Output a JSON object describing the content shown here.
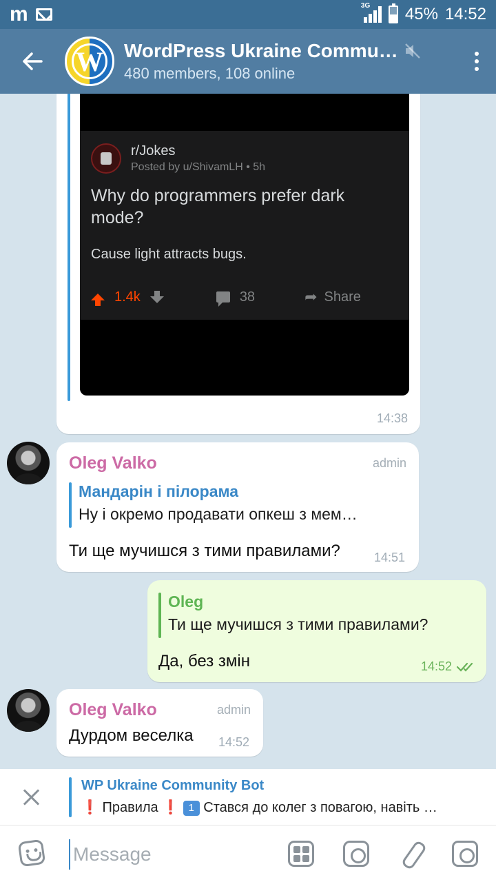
{
  "statusbar": {
    "app_icon": "m",
    "network": "3G",
    "battery": "45%",
    "time": "14:52"
  },
  "header": {
    "title": "WordPress Ukraine Commu…",
    "subtitle": "480 members, 108 online",
    "avatar_letter": "W",
    "mute_icon": "mute-icon"
  },
  "messages": [
    {
      "type": "image",
      "time": "14:38",
      "reddit": {
        "subreddit": "r/Jokes",
        "posted": "Posted by u/ShivamLH • 5h",
        "title": "Why do programmers prefer dark mode?",
        "body": "Cause light attracts bugs.",
        "upvotes": "1.4k",
        "comments": "38",
        "share": "Share"
      }
    },
    {
      "type": "reply",
      "sender": "Oleg Valko",
      "badge": "admin",
      "reply_name": "Мандарін і пілорама",
      "reply_text": "Ну і окремо продавати опкеш з мем…",
      "text": "Ти ще мучишся з тими правилами?",
      "time": "14:51"
    },
    {
      "type": "outgoing",
      "reply_name": "Oleg",
      "reply_text": "Ти ще мучишся з тими правилами?",
      "text": "Да, без змін",
      "time": "14:52"
    },
    {
      "type": "text",
      "sender": "Oleg Valko",
      "badge": "admin",
      "text": "Дурдом веселка",
      "time": "14:52"
    }
  ],
  "pinned": {
    "title": "WP Ukraine Community Bot",
    "exclamation": "❗",
    "rules": "Правила",
    "number": "1",
    "text": "Стався до колег з повагою, навіть …"
  },
  "input": {
    "placeholder": "Message"
  },
  "colors": {
    "header": "#517da2",
    "statusbar": "#3b6e95",
    "chat_bg": "#d5e3ec",
    "outgoing_bubble": "#effdde",
    "sender_name": "#cc6aa5"
  }
}
